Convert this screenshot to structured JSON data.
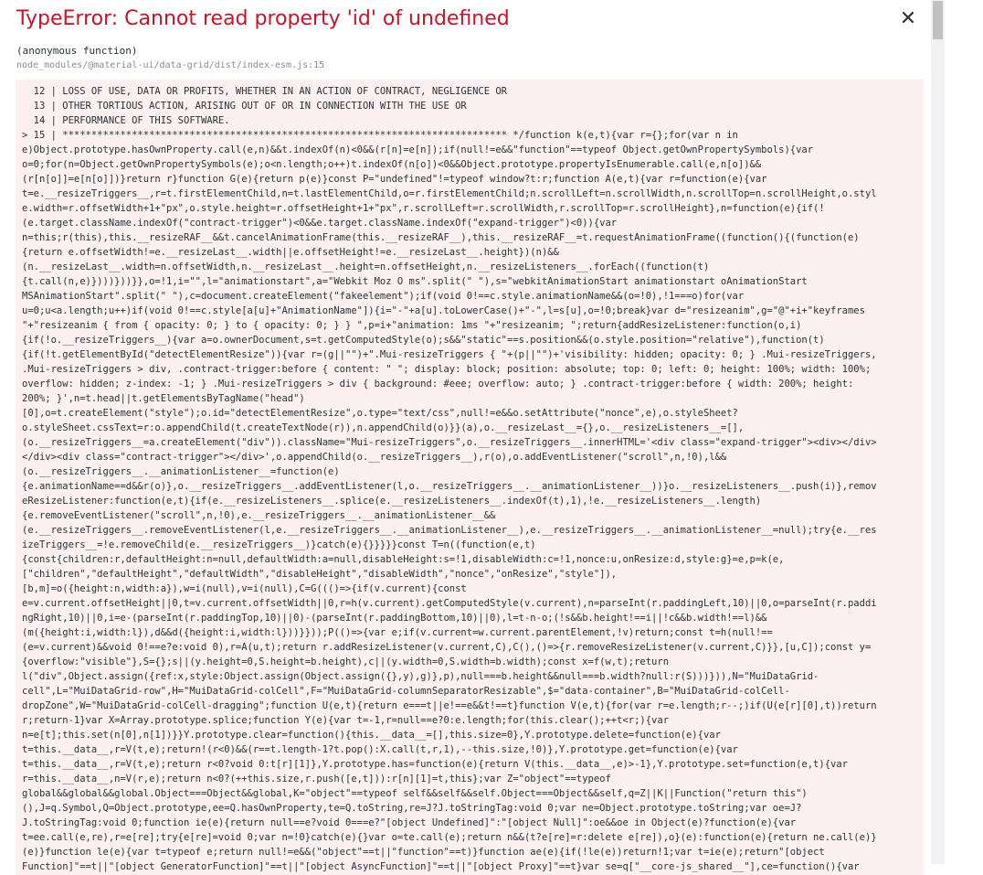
{
  "error": {
    "title": "TypeError: Cannot read property 'id' of undefined",
    "frame_function": "(anonymous function)",
    "frame_file": "node_modules/@material-ui/data-grid/dist/index-esm.js:15",
    "close_icon": "✕"
  },
  "code_lines": [
    "  12 | LOSS OF USE, DATA OR PROFITS, WHETHER IN AN ACTION OF CONTRACT, NEGLIGENCE OR",
    "  13 | OTHER TORTIOUS ACTION, ARISING OUT OF OR IN CONNECTION WITH THE USE OR",
    "  14 | PERFORMANCE OF THIS SOFTWARE.",
    "> 15 | ***************************************************************************** */function k(e,t){var r={};for(var n in",
    "e)Object.prototype.hasOwnProperty.call(e,n)&&t.indexOf(n)<0&&(r[n]=e[n]);if(null!=e&&\"function\"==typeof Object.getOwnPropertySymbols){var",
    "o=0;for(n=Object.getOwnPropertySymbols(e);o<n.length;o++)t.indexOf(n[o])<0&&Object.prototype.propertyIsEnumerable.call(e,n[o])&&",
    "(r[n[o]]=e[n[o]])}return r}function G(e){return p(e)}const P=\"undefined\"!=typeof window?t:r;function A(e,t){var r=function(e){var",
    "t=e.__resizeTriggers__,r=t.firstElementChild,n=t.lastElementChild,o=r.firstElementChild;n.scrollLeft=n.scrollWidth,n.scrollTop=n.scrollHeight,o.styl",
    "e.width=r.offsetWidth+1+\"px\",o.style.height=r.offsetHeight+1+\"px\",r.scrollLeft=r.scrollWidth,r.scrollTop=r.scrollHeight},n=function(e){if(!",
    "(e.target.className.indexOf(\"contract-trigger\")<0&&e.target.className.indexOf(\"expand-trigger\")<0)){var",
    "n=this;r(this),this.__resizeRAF__&&t.cancelAnimationFrame(this.__resizeRAF__),this.__resizeRAF__=t.requestAnimationFrame((function(){(function(e)",
    "{return e.offsetWidth!=e.__resizeLast__.width||e.offsetHeight!=e.__resizeLast__.height})(n)&&",
    "(n.__resizeLast__.width=n.offsetWidth,n.__resizeLast__.height=n.offsetHeight,n.__resizeListeners__.forEach((function(t)",
    "{t.call(n,e)})))}))}},o=!1,i=\"\",l=\"animationstart\",a=\"Webkit Moz O ms\".split(\" \"),s=\"webkitAnimationStart animationstart oAnimationStart",
    "MSAnimationStart\".split(\" \"),c=document.createElement(\"fakeelement\");if(void 0!==c.style.animationName&&(o=!0),!1===o)for(var",
    "u=0;u<a.length;u++)if(void 0!==c.style[a[u]+\"AnimationName\"]){i=\"-\"+a[u].toLowerCase()+\"-\",l=s[u],o=!0;break}var d=\"resizeanim\",g=\"@\"+i+\"keyframes",
    "\"+\"resizeanim { from { opacity: 0; } to { opacity: 0; } } \",p=i+\"animation: 1ms \"+\"resizeanim; \";return{addResizeListener:function(o,i)",
    "{if(!o.__resizeTriggers__){var a=o.ownerDocument,s=t.getComputedStyle(o);s&&\"static\"==s.position&&(o.style.position=\"relative\"),function(t)",
    "{if(!t.getElementById(\"detectElementResize\")){var r=(g||\"\")+\".Mui-resizeTriggers { \"+(p||\"\")+'visibility: hidden; opacity: 0; } .Mui-resizeTriggers,",
    ".Mui-resizeTriggers > div, .contract-trigger:before { content: \" \"; display: block; position: absolute; top: 0; left: 0; height: 100%; width: 100%;",
    "overflow: hidden; z-index: -1; } .Mui-resizeTriggers > div { background: #eee; overflow: auto; } .contract-trigger:before { width: 200%; height:",
    "200%; }',n=t.head||t.getElementsByTagName(\"head\")",
    "[0],o=t.createElement(\"style\");o.id=\"detectElementResize\",o.type=\"text/css\",null!=e&&o.setAttribute(\"nonce\",e),o.styleSheet?",
    "o.styleSheet.cssText=r:o.appendChild(t.createTextNode(r)),n.appendChild(o)}}(a),o.__resizeLast__={},o.__resizeListeners__=[],",
    "(o.__resizeTriggers__=a.createElement(\"div\")).className=\"Mui-resizeTriggers\",o.__resizeTriggers__.innerHTML='<div class=\"expand-trigger\"><div></div>",
    "</div><div class=\"contract-trigger\"></div>',o.appendChild(o.__resizeTriggers__),r(o),o.addEventListener(\"scroll\",n,!0),l&&",
    "(o.__resizeTriggers__.__animationListener__=function(e)",
    "{e.animationName==d&&r(o)},o.__resizeTriggers__.addEventListener(l,o.__resizeTriggers__.__animationListener__))}o.__resizeListeners__.push(i)},remov",
    "eResizeListener:function(e,t){if(e.__resizeListeners__.splice(e.__resizeListeners__.indexOf(t),1),!e.__resizeListeners__.length)",
    "{e.removeEventListener(\"scroll\",n,!0),e.__resizeTriggers__.__animationListener__&&",
    "(e.__resizeTriggers__.removeEventListener(l,e.__resizeTriggers__.__animationListener__),e.__resizeTriggers__.__animationListener__=null);try{e.__res",
    "izeTriggers__=!e.removeChild(e.__resizeTriggers__)}catch(e){}}}}}const T=n((function(e,t)",
    "{const{children:r,defaultHeight:n=null,defaultWidth:a=null,disableHeight:s=!1,disableWidth:c=!1,nonce:u,onResize:d,style:g}=e,p=k(e,",
    "[\"children\",\"defaultHeight\",\"defaultWidth\",\"disableHeight\",\"disableWidth\",\"nonce\",\"onResize\",\"style\"]),",
    "[b,m]=o({height:n,width:a}),w=i(null),v=i(null),C=G((()=>{if(v.current){const",
    "e=v.current.offsetHeight||0,t=v.current.offsetWidth||0,r=h(v.current).getComputedStyle(v.current),n=parseInt(r.paddingLeft,10)||0,o=parseInt(r.paddi",
    "ngRight,10)||0,i=e-(parseInt(r.paddingTop,10)||0)-(parseInt(r.paddingBottom,10)||0),l=t-n-o;(!s&&b.height!==i||!c&&b.width!==l)&&",
    "(m({height:i,width:l}),d&&d({height:i,width:l}))}}));P(()=>{var e;if(v.current=w.current.parentElement,!v)return;const t=h(null!==",
    "(e=v.current)&&void 0!==e?e:void 0),r=A(u,t);return r.addResizeListener(v.current,C),C(),()=>{r.removeResizeListener(v.current,C)}},[u,C]);const y=",
    "{overflow:\"visible\"},S={};s||(y.height=0,S.height=b.height),c||(y.width=0,S.width=b.width);const x=f(w,t);return",
    "l(\"div\",Object.assign({ref:x,style:Object.assign(Object.assign({},y),g)},p),null===b.height&&null===b.width?null:r(S)))})),N=\"MuiDataGrid-",
    "cell\",L=\"MuiDataGrid-row\",H=\"MuiDataGrid-colCell\",F=\"MuiDataGrid-columnSeparatorResizable\",$=\"data-container\",B=\"MuiDataGrid-colCell-",
    "dropZone\",W=\"MuiDataGrid-colCell-dragging\";function U(e,t){return e===t||e!==e&&t!==t}function V(e,t){for(var r=e.length;r--;)if(U(e[r][0],t))return",
    "r;return-1}var X=Array.prototype.splice;function Y(e){var t=-1,r=null==e?0:e.length;for(this.clear();++t<r;){var",
    "n=e[t];this.set(n[0],n[1])}}Y.prototype.clear=function(){this.__data__=[],this.size=0},Y.prototype.delete=function(e){var",
    "t=this.__data__,r=V(t,e);return!(r<0)&&(r==t.length-1?t.pop():X.call(t,r,1),--this.size,!0)},Y.prototype.get=function(e){var",
    "t=this.__data__,r=V(t,e);return r<0?void 0:t[r][1]},Y.prototype.has=function(e){return V(this.__data__,e)>-1},Y.prototype.set=function(e,t){var",
    "r=this.__data__,n=V(r,e);return n<0?(++this.size,r.push([e,t])):r[n][1]=t,this};var Z=\"object\"==typeof",
    "global&&global&&global.Object===Object&&global,K=\"object\"==typeof self&&self&&self.Object===Object&&self,q=Z||K||Function(\"return this\")",
    "(),J=q.Symbol,Q=Object.prototype,ee=Q.hasOwnProperty,te=Q.toString,re=J?J.toStringTag:void 0;var ne=Object.prototype.toString;var oe=J?",
    "J.toStringTag:void 0;function ie(e){return null==e?void 0===e?\"[object Undefined]\":\"[object Null]\":oe&&oe in Object(e)?function(e){var",
    "t=ee.call(e,re),r=e[re];try{e[re]=void 0;var n=!0}catch(e){}var o=te.call(e);return n&&(t?e[re]=r:delete e[re]),o}(e):function(e){return ne.call(e)}",
    "(e)}function le(e){var t=typeof e;return null!=e&&(\"object\"==t||\"function\"==t)}function ae(e){if(!le(e))return!1;var t=ie(e);return\"[object",
    "Function]\"==t||\"[object GeneratorFunction]\"==t||\"[object AsyncFunction]\"==t||\"[object Proxy]\"==t}var se=q[\"__core-js_shared__\"],ce=function(){var"
  ]
}
